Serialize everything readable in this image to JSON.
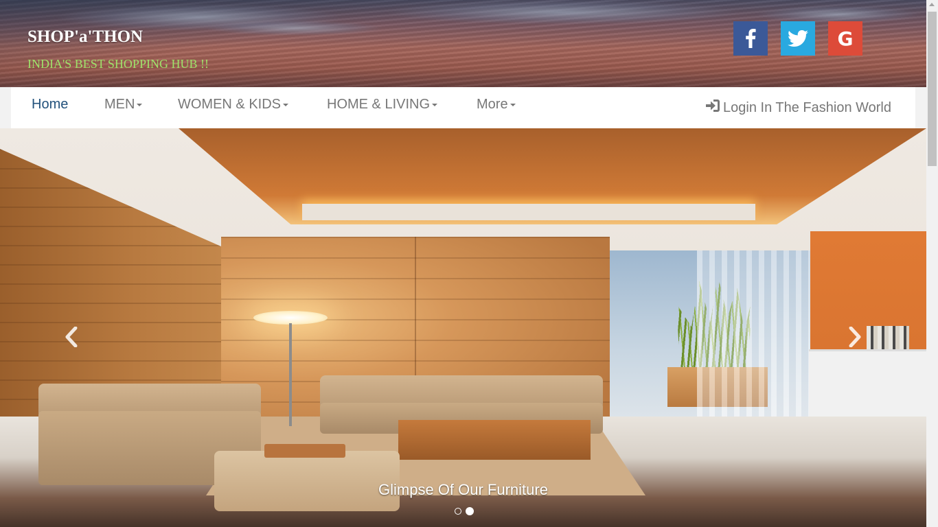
{
  "header": {
    "brand_title": "SHOP'a'THON",
    "tagline": "INDIA'S BEST SHOPPING HUB !!",
    "social": [
      {
        "name": "facebook",
        "icon": "facebook-icon",
        "color": "#3b5998"
      },
      {
        "name": "twitter",
        "icon": "twitter-icon",
        "color": "#29a9e0"
      },
      {
        "name": "google",
        "icon": "google-icon",
        "color": "#dd4b39",
        "glyph": "G"
      }
    ]
  },
  "nav": {
    "items": [
      {
        "label": "Home",
        "active": true,
        "dropdown": false
      },
      {
        "label": "MEN",
        "active": false,
        "dropdown": true
      },
      {
        "label": "WOMEN & KIDS",
        "active": false,
        "dropdown": true
      },
      {
        "label": "HOME & LIVING",
        "active": false,
        "dropdown": true
      },
      {
        "label": "More",
        "active": false,
        "dropdown": true
      }
    ],
    "login_label": "Login In The Fashion World",
    "login_icon": "log-in-icon"
  },
  "carousel": {
    "caption": "Glimpse Of Our Furniture",
    "slide_count": 2,
    "active_index": 1,
    "prev_icon": "chevron-left-icon",
    "next_icon": "chevron-right-icon"
  },
  "colors": {
    "tagline": "#9fe36a",
    "nav_active": "#23527c",
    "nav_text": "#777777"
  }
}
